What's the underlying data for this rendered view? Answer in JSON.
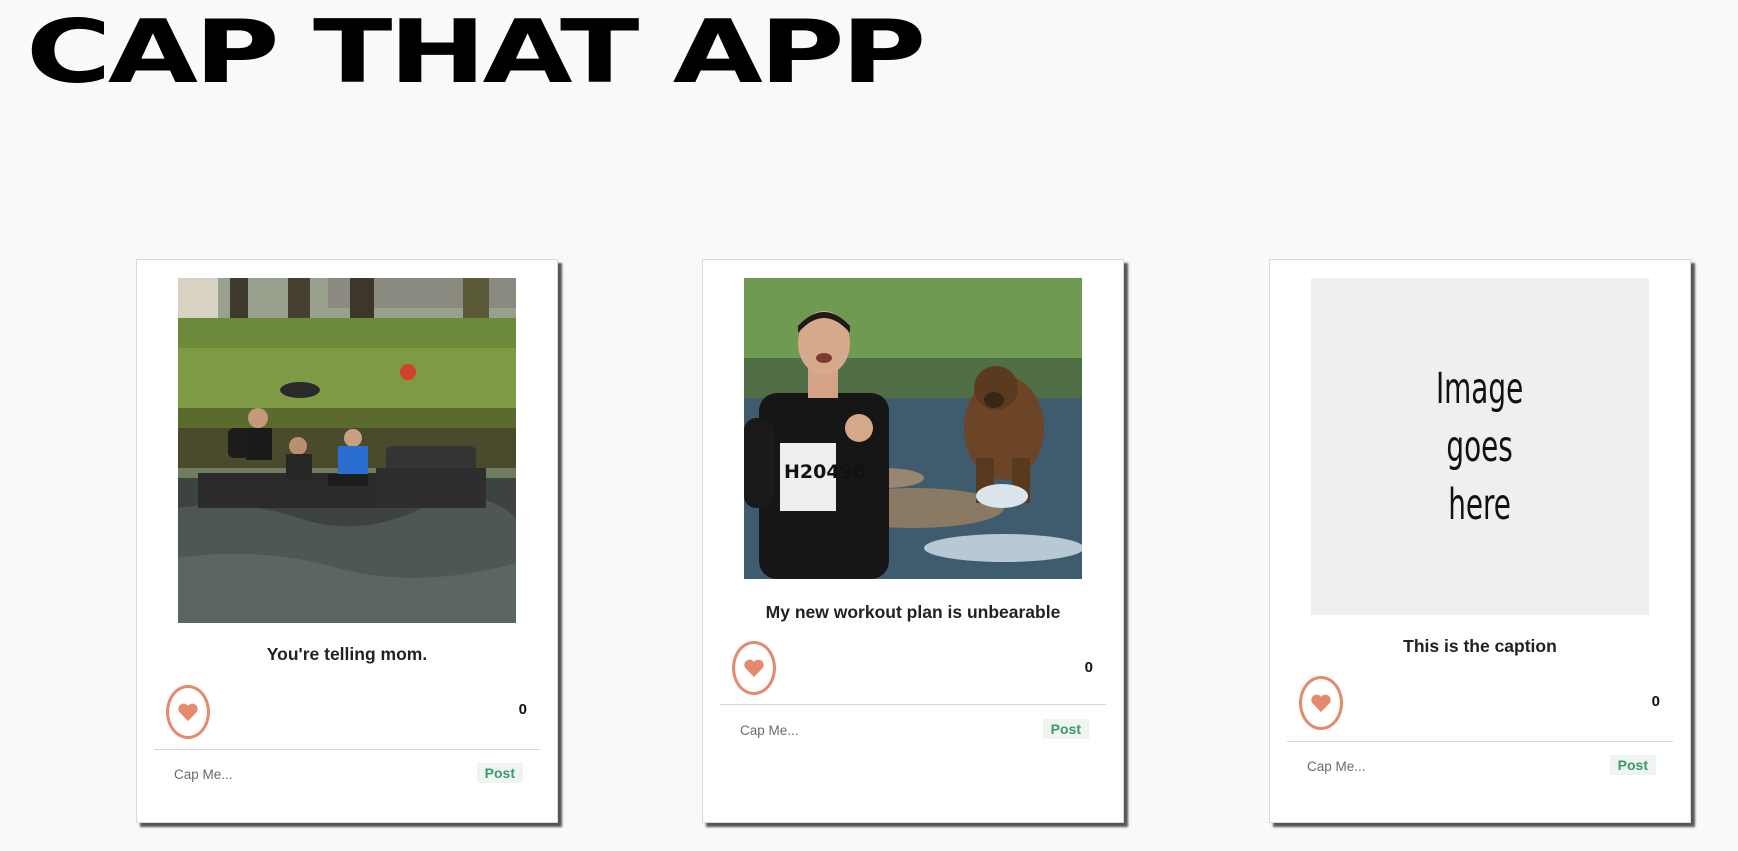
{
  "app": {
    "title": "CAP THAT APP"
  },
  "colors": {
    "heart": "#e38b6c",
    "post_text": "#3a9a6a",
    "post_bg": "#eef5f1"
  },
  "cards": [
    {
      "caption": "You're telling mom.",
      "likes": "0",
      "input_placeholder": "Cap Me...",
      "post_label": "Post",
      "image": "photo: three young men on a leather couch in a river"
    },
    {
      "caption": "My new workout plan is unbearable",
      "likes": "0",
      "input_placeholder": "Cap Me...",
      "post_label": "Post",
      "image": "photo: marathon runner with bib H20496 chased by a bear",
      "bib": "H20496"
    },
    {
      "caption": "This is the caption",
      "likes": "0",
      "input_placeholder": "Cap Me...",
      "post_label": "Post",
      "image": "placeholder",
      "placeholder_text": "Image\ngoes\nhere"
    }
  ]
}
